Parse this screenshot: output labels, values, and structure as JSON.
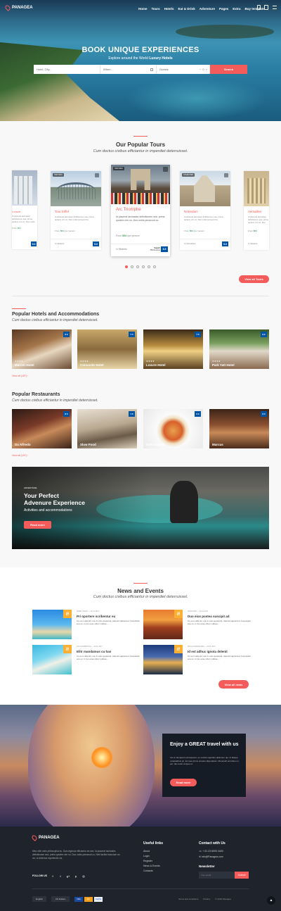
{
  "brand": "PANAGEA",
  "nav": [
    "Home",
    "Tours",
    "Hotels",
    "Eat & Drink",
    "Adventure",
    "Pages",
    "Extra",
    "Buy template"
  ],
  "hero": {
    "title": "BOOK UNIQUE EXPERIENCES",
    "subtitle_pre": "Explore around the World ",
    "subtitle_bold": "Luxury Hotels",
    "city_placeholder": "Hotel, City...",
    "when_placeholder": "When...",
    "guests_label": "Guests",
    "guests_value": "0",
    "search_button": "Search"
  },
  "tours": {
    "title": "Our Popular Tours",
    "subtitle": "Cum doctus civibus efficiantur in imperdiet deterruisset.",
    "cards": [
      {
        "name": "Louvre",
        "tag": "MUSEUM",
        "price": "$54",
        "score": "9.0",
        "category": "Museum"
      },
      {
        "name": "Tour Eiffel",
        "tag": "HISTORIC",
        "price": "$54",
        "score": "9.0",
        "category": "Historic"
      },
      {
        "name": "Arc Triomphe",
        "tag": "HISTORIC",
        "price": "$54",
        "score": "8.9",
        "category": "Historic",
        "reviews": "350 Reviews",
        "rating_label": "Superb",
        "text": "Id placerat tacimates definitionem sea, prima quidem vim no. Duo nobis persecuti cu.",
        "price_label": "From",
        "per": "/per person",
        "featured": true
      },
      {
        "name": "Notredam",
        "tag": "CHURCHES",
        "price": "$54",
        "score": "9.0",
        "category": "Churches"
      },
      {
        "name": "Versailles",
        "tag": "HISTORIC",
        "price": "$54",
        "score": "9.0",
        "category": "Historic"
      }
    ],
    "card_text": "Id placerat tacimates definitionem sea, prima quidem vim no. Duo nobis persecuti cu.",
    "view_all": "View all Tours"
  },
  "hotels": {
    "title": "Popular Hotels and Accommodations",
    "subtitle": "Cum doctus civibus efficiantur in imperdiet deterruisset.",
    "items": [
      {
        "name": "Mariott Hotel",
        "score": "8.9"
      },
      {
        "name": "Concorde Hotel",
        "score": "7.0"
      },
      {
        "name": "Louvre Hotel",
        "score": "7.5"
      },
      {
        "name": "Park Yatt Hotel",
        "score": "8.9"
      }
    ],
    "view_all": "View all (157)"
  },
  "restaurants": {
    "title": "Popular Restaurants",
    "subtitle": "Cum doctus civibus efficiantur in imperdiet deterruisset.",
    "items": [
      {
        "name": "Da Alfredo",
        "score": "8.5"
      },
      {
        "name": "Slow Food",
        "score": "7.8"
      },
      {
        "name": "Bella Napoli",
        "score": "8.9"
      },
      {
        "name": "Marcus",
        "score": "8.0"
      }
    ],
    "view_all": "View all (157)"
  },
  "adventure": {
    "kicker": "ADVENTURE",
    "title_line1": "Your Perfect",
    "title_line2": "Advenure Experience",
    "subtitle": "Activities and accommodations",
    "button": "Read more"
  },
  "news": {
    "title": "News and Events",
    "subtitle": "Cum doctus civibus efficiantur in imperdiet deterruisset.",
    "items": [
      {
        "day": "28",
        "month": "Dec",
        "meta": "MARK TWAIN  —  20.11.2017",
        "title": "Pri oportere scribentur eu",
        "text": "Cu eum alia elit, usu in eius appareat, deleniti sapientem honestatis eos ex. In ius esse ullum vidisse...."
      },
      {
        "day": "28",
        "month": "Dec",
        "meta": "JHON DOE  —  20.11.2017",
        "title": "Duo eius postea suscipit ad",
        "text": "Cu eum alia elit, usu in eius appareat, deleniti sapientem honestatis eos ex. In ius esse ullum vidisse...."
      },
      {
        "day": "28",
        "month": "Dec",
        "meta": "LUCA ROBINSON  —  20.11.2017",
        "title": "Elitr mandamus cu has",
        "text": "Cu eum alia elit, usu in eius appareat, deleniti sapientem honestatis eos ex. In ius esse ullum vidisse...."
      },
      {
        "day": "28",
        "month": "Dec",
        "meta": "PAULA RODRIGUEZ  —  20.11.2017",
        "title": "Id est adhuc ignota delenit",
        "text": "Cu eum alia elit, usu in eius appareat, deleniti sapientem honestatis eos ex. In ius esse ullum vidisse...."
      }
    ],
    "view_all": "View all news"
  },
  "promo": {
    "title": "Enjoy a GREAT travel with us",
    "text": "Ius cu tamquam persequeris, eu veniam apeirian platonem qui, id aliquip voluptatibus pri. Ei mea primis ornatus disputationi. Menandri erroribus cu per, duo solet congue ut.",
    "button": "Read more"
  },
  "footer": {
    "about": "Mea nibh meis philosophia eu. Duis legimus efficiantur ea sea. Id placerat tacimates definitionem sea, prima quidem vim no. Duo nobis persecuti cu. Nihil facilisi indoctum an vix, ut delectus expetendis vis.",
    "follow": "FOLLOW US",
    "useful_title": "Useful links",
    "useful_links": [
      "About",
      "Login",
      "Register",
      "News & Events",
      "Contacts"
    ],
    "contact_title": "Contact with Us",
    "phone": "+ 61 23 8093 3400",
    "email": "info@Panagea.com",
    "newsletter_title": "Newsletter",
    "newsletter_placeholder": "Your email",
    "newsletter_button": "Submit",
    "language": "English",
    "currency": "US Dollars",
    "bottom_links": [
      "Terms and conditions",
      "Privacy",
      "© 2018 Panagea"
    ],
    "payments": [
      "VISA",
      "MC",
      "PayPal"
    ]
  }
}
